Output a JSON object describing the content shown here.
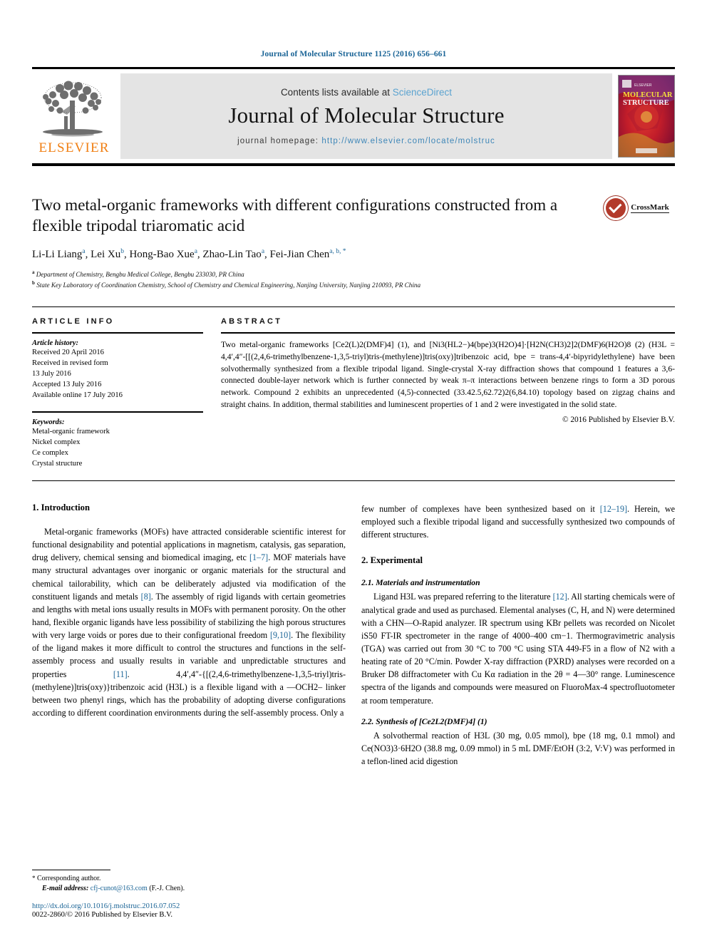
{
  "running_head": "Journal of Molecular Structure 1125 (2016) 656–661",
  "masthead": {
    "elsevier_wordmark": "ELSEVIER",
    "contents_prefix": "Contents lists available at ",
    "sciencedirect": "ScienceDirect",
    "journal_title": "Journal of Molecular Structure",
    "homepage_prefix": "journal homepage: ",
    "homepage_url": "http://www.elsevier.com/locate/molstruc",
    "cover_line1": "MOLECULAR",
    "cover_line2": "STRUCTURE"
  },
  "title": "Two metal-organic frameworks with different configurations constructed from a flexible tripodal triaromatic acid",
  "authors": [
    {
      "name": "Li-Li Liang",
      "sup": "a"
    },
    {
      "name": "Lei Xu",
      "sup": "b"
    },
    {
      "name": "Hong-Bao Xue",
      "sup": "a"
    },
    {
      "name": "Zhao-Lin Tao",
      "sup": "a"
    },
    {
      "name": "Fei-Jian Chen",
      "sup": "a, b, *"
    }
  ],
  "affiliations": [
    {
      "marker": "a",
      "text": "Department of Chemistry, Bengbu Medical College, Bengbu 233030, PR China"
    },
    {
      "marker": "b",
      "text": "State Key Laboratory of Coordination Chemistry, School of Chemistry and Chemical Engineering, Nanjing University, Nanjing 210093, PR China"
    }
  ],
  "crossmark_label": "CrossMark",
  "article_info": {
    "heading": "ARTICLE INFO",
    "history_label": "Article history:",
    "history": [
      "Received 20 April 2016",
      "Received in revised form",
      "13 July 2016",
      "Accepted 13 July 2016",
      "Available online 17 July 2016"
    ],
    "keywords_label": "Keywords:",
    "keywords": [
      "Metal-organic framework",
      "Nickel complex",
      "Ce complex",
      "Crystal structure"
    ]
  },
  "abstract": {
    "heading": "ABSTRACT",
    "text": "Two metal-organic frameworks [Ce2(L)2(DMF)4] (1), and [Ni3(HL2−)4(bpe)3(H2O)4]·[H2N(CH3)2]2(DMF)6(H2O)8 (2) (H3L = 4,4′,4″-[[(2,4,6-trimethylbenzene-1,3,5-triyl)tris-(methylene)]tris(oxy)]tribenzoic acid, bpe = trans-4,4′-bipyridylethylene) have been solvothermally synthesized from a flexible tripodal ligand. Single-crystal X-ray diffraction shows that compound 1 features a 3,6-connected double-layer network which is further connected by weak π–π interactions between benzene rings to form a 3D porous network. Compound 2 exhibits an unprecedented (4,5)-connected (33.42.5,62.72)2(6,84.10) topology based on zigzag chains and straight chains. In addition, thermal stabilities and luminescent properties of 1 and 2 were investigated in the solid state.",
    "copyright": "© 2016 Published by Elsevier B.V."
  },
  "sections": {
    "intro_heading": "1. Introduction",
    "intro_p1_a": "Metal-organic frameworks (MOFs) have attracted considerable scientific interest for functional designability and potential applications in magnetism, catalysis, gas separation, drug delivery, chemical sensing and biomedical imaging, etc ",
    "intro_ref_1_7": "[1–7]",
    "intro_p1_b": ". MOF materials have many structural advantages over inorganic or organic materials for the structural and chemical tailorability, which can be deliberately adjusted via modification of the constituent ligands and metals ",
    "intro_ref_8": "[8]",
    "intro_p1_c": ". The assembly of rigid ligands with certain geometries and lengths with metal ions usually results in MOFs with permanent porosity. On the other hand, flexible organic ligands have less possibility of stabilizing the high porous structures with very large voids or pores due to their configurational freedom ",
    "intro_ref_9_10": "[9,10]",
    "intro_p1_d": ". The flexibility of the ligand makes it more difficult to control the structures and functions in the self-assembly process and usually results in variable and unpredictable structures and properties ",
    "intro_ref_11": "[11]",
    "intro_p1_e": ". 4,4′,4″-{[(2,4,6-trimethylbenzene-1,3,5-triyl)tris-(methylene)]tris(oxy)}tribenzoic acid (H3L) is a flexible ligand with a —OCH2– linker between two phenyl rings, which has the probability of adopting diverse configurations according to different coordination environments during the self-assembly process. Only a ",
    "intro_p2_a": "few number of complexes have been synthesized based on it ",
    "intro_ref_12_19": "[12–19]",
    "intro_p2_b": ". Herein, we employed such a flexible tripodal ligand and successfully synthesized two compounds of different structures.",
    "experimental_heading": "2. Experimental",
    "sub21_heading": "2.1. Materials and instrumentation",
    "sub21_a": "Ligand H3L was prepared referring to the literature ",
    "sub21_ref_12": "[12]",
    "sub21_b": ". All starting chemicals were of analytical grade and used as purchased. Elemental analyses (C, H, and N) were determined with a CHN—O-Rapid analyzer. IR spectrum using KBr pellets was recorded on Nicolet iS50 FT-IR spectrometer in the range of 4000–400 cm−1. Thermogravimetric analysis (TGA) was carried out from 30 °C to 700 °C using STA 449-F5 in a flow of N2 with a heating rate of 20 °C/min. Powder X-ray diffraction (PXRD) analyses were recorded on a Bruker D8 diffractometer with Cu Kα radiation in the 2θ = 4—30° range. Luminescence spectra of the ligands and compounds were measured on FluoroMax-4 spectrofluotometer at room temperature.",
    "sub22_heading": "2.2. Synthesis of [Ce2L2(DMF)4] (1)",
    "sub22_text": "A solvothermal reaction of H3L (30 mg, 0.05 mmol), bpe (18 mg, 0.1 mmol) and Ce(NO3)3·6H2O (38.8 mg, 0.09 mmol) in 5 mL DMF/EtOH (3:2, V:V) was performed in a teflon-lined acid digestion"
  },
  "footer": {
    "corresponding_star": "*",
    "corresponding_label": "Corresponding author.",
    "email_label": "E-mail address:",
    "email": "cfj-cunot@163.com",
    "email_suffix": "(F.-J. Chen).",
    "doi": "http://dx.doi.org/10.1016/j.molstruc.2016.07.052",
    "issn": "0022-2860/© 2016 Published by Elsevier B.V."
  },
  "colors": {
    "link": "#1a6496",
    "sciencedirect": "#5ba3d0",
    "elsevier_orange": "#f07f13",
    "crossmark_red": "#b33a2b"
  }
}
